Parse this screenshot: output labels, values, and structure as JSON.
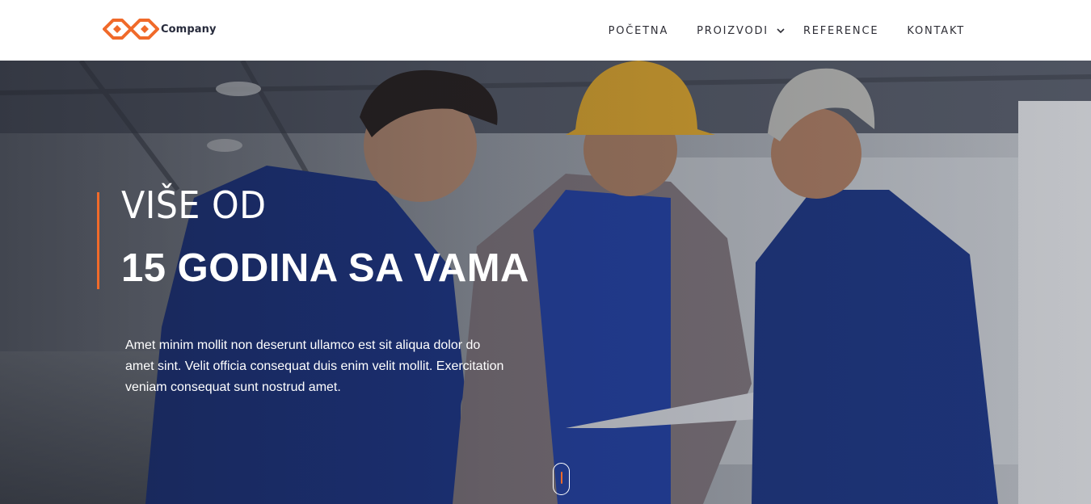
{
  "header": {
    "logo_text": "Company",
    "nav": [
      {
        "label": "POČETNA"
      },
      {
        "label": "PROIZVODI",
        "has_dropdown": true
      },
      {
        "label": "REFERENCE"
      },
      {
        "label": "KONTAKT"
      }
    ]
  },
  "hero": {
    "line1": "VIŠE OD",
    "line2": "15 GODINA SA VAMA",
    "text": "Amet minim mollit non deserunt ullamco est sit aliqua dolor do amet sint. Velit officia consequat duis enim velit mollit. Exercitation veniam consequat sunt nostrud amet.",
    "scroll_label": ""
  },
  "colors": {
    "accent": "#f06a2a",
    "nav_text": "#2e2e36",
    "logo_text": "#262a3b"
  },
  "icons": [
    "company-logo-icon",
    "chevron-down-icon",
    "scroll-mouse-icon"
  ]
}
